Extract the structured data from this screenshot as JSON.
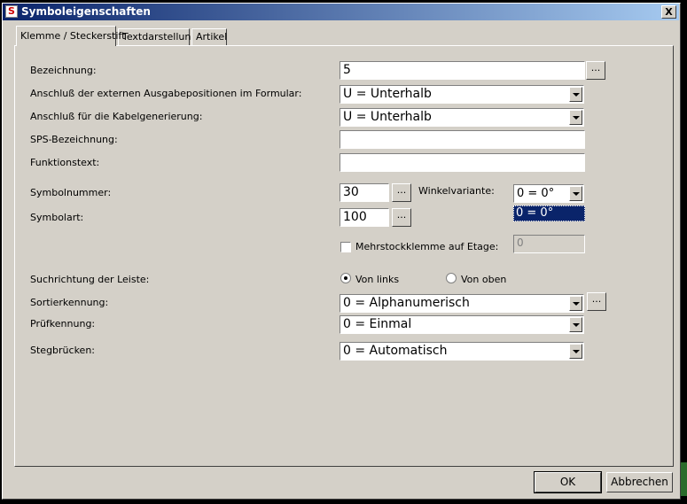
{
  "window": {
    "title": "Symboleigenschaften",
    "close_label": "X"
  },
  "tabs": [
    {
      "label": "Klemme / Steckerstift"
    },
    {
      "label": "Textdarstellung"
    },
    {
      "label": "Artikel"
    }
  ],
  "form": {
    "bezeichnung": {
      "label": "Bezeichnung:",
      "value": "5"
    },
    "anschluss_formular": {
      "label": "Anschluß der externen Ausgabepositionen im Formular:",
      "value": "U = Unterhalb"
    },
    "anschluss_kabel": {
      "label": "Anschluß für die Kabelgenerierung:",
      "value": "U = Unterhalb"
    },
    "sps": {
      "label": "SPS-Bezeichnung:",
      "value": ""
    },
    "funktionstext": {
      "label": "Funktionstext:",
      "value": ""
    },
    "symbolnummer": {
      "label": "Symbolnummer:",
      "value": "30"
    },
    "winkelvariante": {
      "label": "Winkelvariante:",
      "value": "0 = 0°",
      "highlighted_option": "0 = 0°"
    },
    "symbolart": {
      "label": "Symbolart:",
      "value": "100"
    },
    "mehrstock": {
      "label": "Mehrstockklemme auf Etage:",
      "checked": false,
      "value": "0"
    },
    "suchrichtung": {
      "label": "Suchrichtung der Leiste:",
      "option1": "Von links",
      "option2": "Von oben",
      "selected": "Von links"
    },
    "sortierkennung": {
      "label": "Sortierkennung:",
      "value": "0 = Alphanumerisch"
    },
    "pruefkennung": {
      "label": "Prüfkennung:",
      "value": "0 = Einmal"
    },
    "stegbruecken": {
      "label": "Stegbrücken:",
      "value": "0 = Automatisch"
    }
  },
  "buttons": {
    "browse": "...",
    "ok": "OK",
    "cancel": "Abbrechen"
  }
}
